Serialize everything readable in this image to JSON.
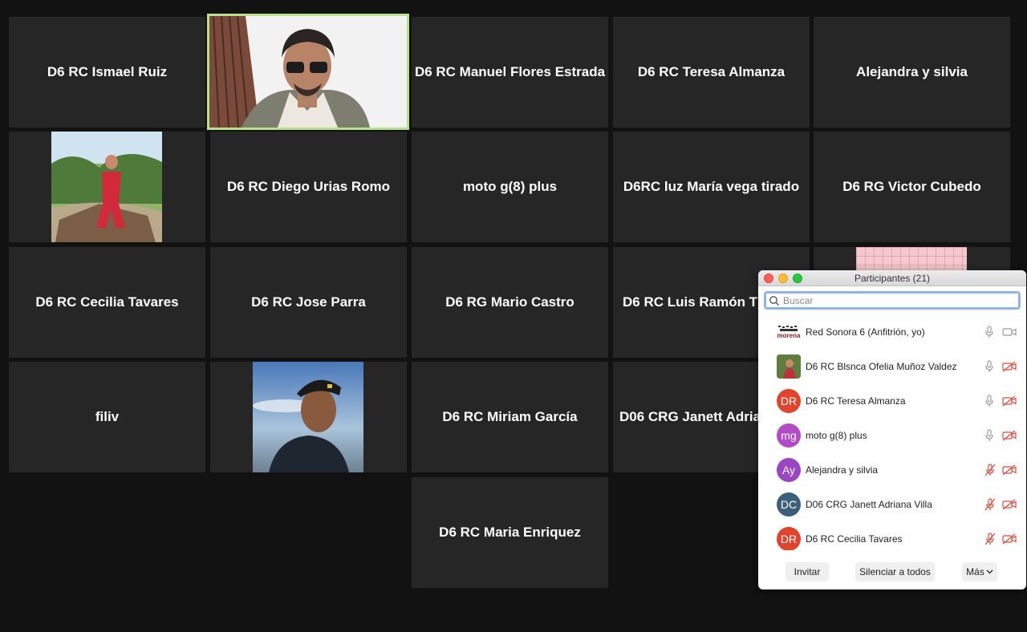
{
  "gallery": {
    "tiles": [
      {
        "name": "D6 RC Ismael Ruiz"
      },
      {
        "name": ""
      },
      {
        "name": "D6 RC Manuel Flores Estrada"
      },
      {
        "name": "D6 RC Teresa Almanza"
      },
      {
        "name": "Alejandra y silvia"
      },
      {
        "name": ""
      },
      {
        "name": "D6 RC Diego Urias Romo"
      },
      {
        "name": "moto g(8) plus"
      },
      {
        "name": "D6RC luz María vega tirado"
      },
      {
        "name": "D6 RG Victor Cubedo"
      },
      {
        "name": "D6 RC Cecilia Tavares"
      },
      {
        "name": "D6 RC Jose Parra"
      },
      {
        "name": "D6 RG Mario Castro"
      },
      {
        "name": "D6 RC Luis Ramón Th"
      },
      {
        "name": ""
      },
      {
        "name": "filiv"
      },
      {
        "name": ""
      },
      {
        "name": "D6 RC Miriam García"
      },
      {
        "name": "D06 CRG Janett Adria"
      },
      {
        "name": ""
      },
      {
        "name": "D6 RC Maria Enriquez"
      }
    ]
  },
  "participants": {
    "title": "Participantes (21)",
    "search_placeholder": "Buscar",
    "items": [
      {
        "name": "Red Sonora 6 (Anfitrión, yo)",
        "initials": "",
        "color": "#ffffff",
        "mic": "on",
        "cam": "on"
      },
      {
        "name": "D6 RC Blsnca Ofelia Muñoz Valdez",
        "initials": "",
        "color": "#6b8a4a",
        "mic": "on",
        "cam": "off"
      },
      {
        "name": "D6 RC Teresa Almanza",
        "initials": "DR",
        "color": "#e2432d",
        "mic": "on",
        "cam": "off"
      },
      {
        "name": "moto g(8) plus",
        "initials": "mg",
        "color": "#b34bc6",
        "mic": "on",
        "cam": "off"
      },
      {
        "name": "Alejandra y silvia",
        "initials": "Ay",
        "color": "#9a45c2",
        "mic": "off",
        "cam": "off"
      },
      {
        "name": "D06 CRG Janett Adriana Villa",
        "initials": "DC",
        "color": "#3e5f7a",
        "mic": "off",
        "cam": "off"
      },
      {
        "name": "D6 RC Cecilia Tavares",
        "initials": "DR",
        "color": "#e2432d",
        "mic": "off",
        "cam": "off"
      }
    ],
    "footer": {
      "invite_label": "Invitar",
      "mute_all_label": "Silenciar a todos",
      "more_label": "Más"
    }
  },
  "colors": {
    "active_speaker_border": "#b6e28a",
    "tile_bg": "#262626",
    "muted_red": "#e04a3a"
  },
  "icons": [
    "search-icon",
    "mic-icon",
    "mic-muted-icon",
    "video-icon",
    "video-off-icon",
    "chevron-down-icon"
  ]
}
